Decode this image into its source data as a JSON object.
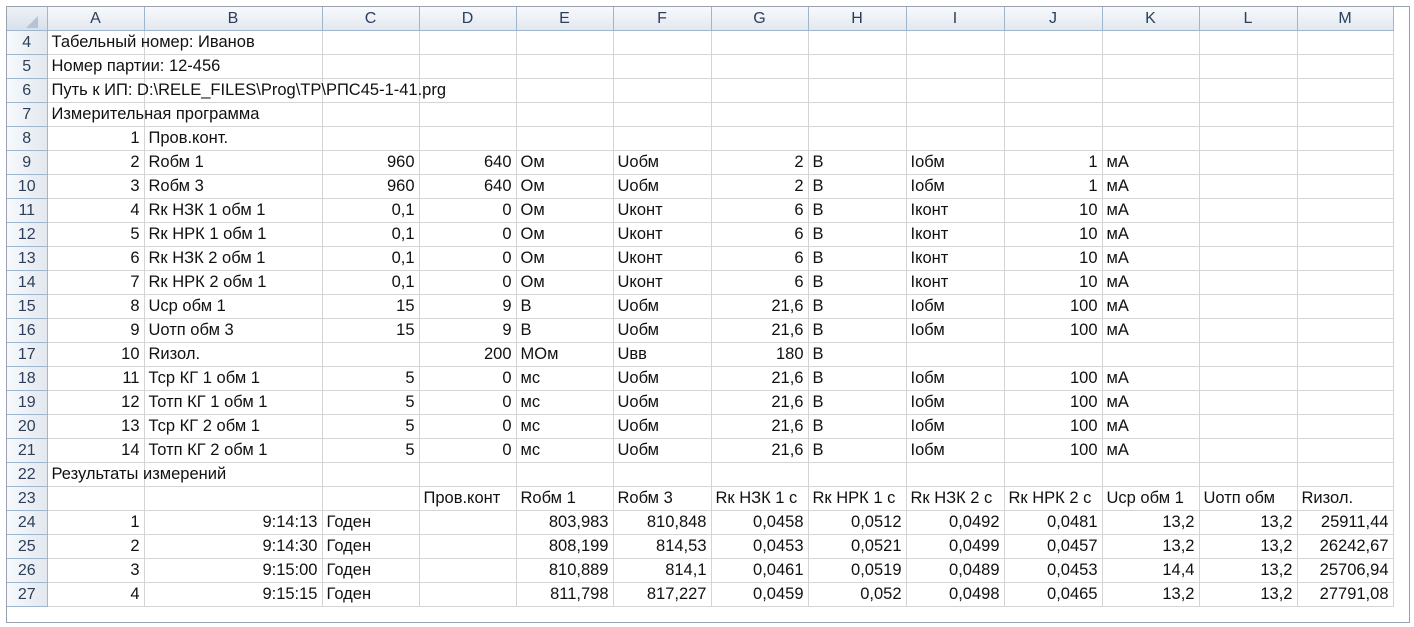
{
  "columns": [
    "A",
    "B",
    "C",
    "D",
    "E",
    "F",
    "G",
    "H",
    "I",
    "J",
    "K",
    "L",
    "M"
  ],
  "rows": [
    {
      "row": "4",
      "cells": [
        {
          "v": "Табельный номер: Иванов",
          "t": "txt",
          "span": 1
        }
      ]
    },
    {
      "row": "5",
      "cells": [
        {
          "v": "Номер партии: 12-456",
          "t": "txt"
        }
      ]
    },
    {
      "row": "6",
      "cells": [
        {
          "v": "Путь к ИП: D:\\RELE_FILES\\Prog\\TP\\РПС45-1-41.prg",
          "t": "txt"
        }
      ]
    },
    {
      "row": "7",
      "cells": [
        {
          "v": "Измерительная программа",
          "t": "txt"
        }
      ]
    },
    {
      "row": "8",
      "cells": [
        {
          "v": "1",
          "t": "num"
        },
        {
          "v": "Пров.конт.",
          "t": "txt"
        }
      ]
    },
    {
      "row": "9",
      "cells": [
        {
          "v": "2",
          "t": "num"
        },
        {
          "v": "Rобм 1",
          "t": "txt"
        },
        {
          "v": "960",
          "t": "num"
        },
        {
          "v": "640",
          "t": "num"
        },
        {
          "v": "Ом",
          "t": "txt"
        },
        {
          "v": "Uобм",
          "t": "txt"
        },
        {
          "v": "2",
          "t": "num"
        },
        {
          "v": "В",
          "t": "txt"
        },
        {
          "v": "Iобм",
          "t": "txt"
        },
        {
          "v": "1",
          "t": "num"
        },
        {
          "v": "мА",
          "t": "txt"
        },
        {
          "v": "",
          "t": "txt"
        },
        {
          "v": "",
          "t": "txt"
        }
      ]
    },
    {
      "row": "10",
      "cells": [
        {
          "v": "3",
          "t": "num"
        },
        {
          "v": "Rобм 3",
          "t": "txt"
        },
        {
          "v": "960",
          "t": "num"
        },
        {
          "v": "640",
          "t": "num"
        },
        {
          "v": "Ом",
          "t": "txt"
        },
        {
          "v": "Uобм",
          "t": "txt"
        },
        {
          "v": "2",
          "t": "num"
        },
        {
          "v": "В",
          "t": "txt"
        },
        {
          "v": "Iобм",
          "t": "txt"
        },
        {
          "v": "1",
          "t": "num"
        },
        {
          "v": "мА",
          "t": "txt"
        },
        {
          "v": "",
          "t": "txt"
        },
        {
          "v": "",
          "t": "txt"
        }
      ]
    },
    {
      "row": "11",
      "cells": [
        {
          "v": "4",
          "t": "num"
        },
        {
          "v": "Rк НЗК 1 обм 1",
          "t": "txt"
        },
        {
          "v": "0,1",
          "t": "num"
        },
        {
          "v": "0",
          "t": "num"
        },
        {
          "v": "Ом",
          "t": "txt"
        },
        {
          "v": "Uконт",
          "t": "txt"
        },
        {
          "v": "6",
          "t": "num"
        },
        {
          "v": "В",
          "t": "txt"
        },
        {
          "v": "Iконт",
          "t": "txt"
        },
        {
          "v": "10",
          "t": "num"
        },
        {
          "v": "мА",
          "t": "txt"
        },
        {
          "v": "",
          "t": "txt"
        },
        {
          "v": "",
          "t": "txt"
        }
      ]
    },
    {
      "row": "12",
      "cells": [
        {
          "v": "5",
          "t": "num"
        },
        {
          "v": "Rк НРК 1 обм 1",
          "t": "txt"
        },
        {
          "v": "0,1",
          "t": "num"
        },
        {
          "v": "0",
          "t": "num"
        },
        {
          "v": "Ом",
          "t": "txt"
        },
        {
          "v": "Uконт",
          "t": "txt"
        },
        {
          "v": "6",
          "t": "num"
        },
        {
          "v": "В",
          "t": "txt"
        },
        {
          "v": "Iконт",
          "t": "txt"
        },
        {
          "v": "10",
          "t": "num"
        },
        {
          "v": "мА",
          "t": "txt"
        },
        {
          "v": "",
          "t": "txt"
        },
        {
          "v": "",
          "t": "txt"
        }
      ]
    },
    {
      "row": "13",
      "cells": [
        {
          "v": "6",
          "t": "num"
        },
        {
          "v": "Rк НЗК 2 обм 1",
          "t": "txt"
        },
        {
          "v": "0,1",
          "t": "num"
        },
        {
          "v": "0",
          "t": "num"
        },
        {
          "v": "Ом",
          "t": "txt"
        },
        {
          "v": "Uконт",
          "t": "txt"
        },
        {
          "v": "6",
          "t": "num"
        },
        {
          "v": "В",
          "t": "txt"
        },
        {
          "v": "Iконт",
          "t": "txt"
        },
        {
          "v": "10",
          "t": "num"
        },
        {
          "v": "мА",
          "t": "txt"
        },
        {
          "v": "",
          "t": "txt"
        },
        {
          "v": "",
          "t": "txt"
        }
      ]
    },
    {
      "row": "14",
      "cells": [
        {
          "v": "7",
          "t": "num"
        },
        {
          "v": "Rк НРК 2 обм 1",
          "t": "txt"
        },
        {
          "v": "0,1",
          "t": "num"
        },
        {
          "v": "0",
          "t": "num"
        },
        {
          "v": "Ом",
          "t": "txt"
        },
        {
          "v": "Uконт",
          "t": "txt"
        },
        {
          "v": "6",
          "t": "num"
        },
        {
          "v": "В",
          "t": "txt"
        },
        {
          "v": "Iконт",
          "t": "txt"
        },
        {
          "v": "10",
          "t": "num"
        },
        {
          "v": "мА",
          "t": "txt"
        },
        {
          "v": "",
          "t": "txt"
        },
        {
          "v": "",
          "t": "txt"
        }
      ]
    },
    {
      "row": "15",
      "cells": [
        {
          "v": "8",
          "t": "num"
        },
        {
          "v": "Uср обм 1",
          "t": "txt"
        },
        {
          "v": "15",
          "t": "num"
        },
        {
          "v": "9",
          "t": "num"
        },
        {
          "v": "В",
          "t": "txt"
        },
        {
          "v": "Uобм",
          "t": "txt"
        },
        {
          "v": "21,6",
          "t": "num"
        },
        {
          "v": "В",
          "t": "txt"
        },
        {
          "v": "Iобм",
          "t": "txt"
        },
        {
          "v": "100",
          "t": "num"
        },
        {
          "v": "мА",
          "t": "txt"
        },
        {
          "v": "",
          "t": "txt"
        },
        {
          "v": "",
          "t": "txt"
        }
      ]
    },
    {
      "row": "16",
      "cells": [
        {
          "v": "9",
          "t": "num"
        },
        {
          "v": "Uотп обм 3",
          "t": "txt"
        },
        {
          "v": "15",
          "t": "num"
        },
        {
          "v": "9",
          "t": "num"
        },
        {
          "v": "В",
          "t": "txt"
        },
        {
          "v": "Uобм",
          "t": "txt"
        },
        {
          "v": "21,6",
          "t": "num"
        },
        {
          "v": "В",
          "t": "txt"
        },
        {
          "v": "Iобм",
          "t": "txt"
        },
        {
          "v": "100",
          "t": "num"
        },
        {
          "v": "мА",
          "t": "txt"
        },
        {
          "v": "",
          "t": "txt"
        },
        {
          "v": "",
          "t": "txt"
        }
      ]
    },
    {
      "row": "17",
      "cells": [
        {
          "v": "10",
          "t": "num"
        },
        {
          "v": "Rизол.",
          "t": "txt"
        },
        {
          "v": "",
          "t": "num"
        },
        {
          "v": "200",
          "t": "num"
        },
        {
          "v": "МОм",
          "t": "txt"
        },
        {
          "v": "Uвв",
          "t": "txt"
        },
        {
          "v": "180",
          "t": "num"
        },
        {
          "v": "В",
          "t": "txt"
        },
        {
          "v": "",
          "t": "txt"
        },
        {
          "v": "",
          "t": "num"
        },
        {
          "v": "",
          "t": "txt"
        },
        {
          "v": "",
          "t": "txt"
        },
        {
          "v": "",
          "t": "txt"
        }
      ]
    },
    {
      "row": "18",
      "cells": [
        {
          "v": "11",
          "t": "num"
        },
        {
          "v": "Тср КГ 1 обм 1",
          "t": "txt"
        },
        {
          "v": "5",
          "t": "num"
        },
        {
          "v": "0",
          "t": "num"
        },
        {
          "v": "мс",
          "t": "txt"
        },
        {
          "v": "Uобм",
          "t": "txt"
        },
        {
          "v": "21,6",
          "t": "num"
        },
        {
          "v": "В",
          "t": "txt"
        },
        {
          "v": "Iобм",
          "t": "txt"
        },
        {
          "v": "100",
          "t": "num"
        },
        {
          "v": "мА",
          "t": "txt"
        },
        {
          "v": "",
          "t": "txt"
        },
        {
          "v": "",
          "t": "txt"
        }
      ]
    },
    {
      "row": "19",
      "cells": [
        {
          "v": "12",
          "t": "num"
        },
        {
          "v": "Тотп КГ 1 обм 1",
          "t": "txt"
        },
        {
          "v": "5",
          "t": "num"
        },
        {
          "v": "0",
          "t": "num"
        },
        {
          "v": "мс",
          "t": "txt"
        },
        {
          "v": "Uобм",
          "t": "txt"
        },
        {
          "v": "21,6",
          "t": "num"
        },
        {
          "v": "В",
          "t": "txt"
        },
        {
          "v": "Iобм",
          "t": "txt"
        },
        {
          "v": "100",
          "t": "num"
        },
        {
          "v": "мА",
          "t": "txt"
        },
        {
          "v": "",
          "t": "txt"
        },
        {
          "v": "",
          "t": "txt"
        }
      ]
    },
    {
      "row": "20",
      "cells": [
        {
          "v": "13",
          "t": "num"
        },
        {
          "v": "Тср КГ 2 обм 1",
          "t": "txt"
        },
        {
          "v": "5",
          "t": "num"
        },
        {
          "v": "0",
          "t": "num"
        },
        {
          "v": "мс",
          "t": "txt"
        },
        {
          "v": "Uобм",
          "t": "txt"
        },
        {
          "v": "21,6",
          "t": "num"
        },
        {
          "v": "В",
          "t": "txt"
        },
        {
          "v": "Iобм",
          "t": "txt"
        },
        {
          "v": "100",
          "t": "num"
        },
        {
          "v": "мА",
          "t": "txt"
        },
        {
          "v": "",
          "t": "txt"
        },
        {
          "v": "",
          "t": "txt"
        }
      ]
    },
    {
      "row": "21",
      "cells": [
        {
          "v": "14",
          "t": "num"
        },
        {
          "v": "Тотп КГ 2 обм 1",
          "t": "txt"
        },
        {
          "v": "5",
          "t": "num"
        },
        {
          "v": "0",
          "t": "num"
        },
        {
          "v": "мс",
          "t": "txt"
        },
        {
          "v": "Uобм",
          "t": "txt"
        },
        {
          "v": "21,6",
          "t": "num"
        },
        {
          "v": "В",
          "t": "txt"
        },
        {
          "v": "Iобм",
          "t": "txt"
        },
        {
          "v": "100",
          "t": "num"
        },
        {
          "v": "мА",
          "t": "txt"
        },
        {
          "v": "",
          "t": "txt"
        },
        {
          "v": "",
          "t": "txt"
        }
      ]
    },
    {
      "row": "22",
      "cells": [
        {
          "v": "Результаты измерений",
          "t": "txt"
        }
      ]
    },
    {
      "row": "23",
      "cells": [
        {
          "v": "",
          "t": "txt"
        },
        {
          "v": "",
          "t": "txt"
        },
        {
          "v": "",
          "t": "txt"
        },
        {
          "v": "Пров.конт",
          "t": "txt"
        },
        {
          "v": "Rобм 1",
          "t": "txt"
        },
        {
          "v": "Rобм 3",
          "t": "txt"
        },
        {
          "v": "Rк НЗК 1 с",
          "t": "txt"
        },
        {
          "v": "Rк НРК 1 с",
          "t": "txt"
        },
        {
          "v": "Rк НЗК 2 с",
          "t": "txt"
        },
        {
          "v": "Rк НРК 2 с",
          "t": "txt"
        },
        {
          "v": "Uср обм 1",
          "t": "txt"
        },
        {
          "v": "Uотп обм",
          "t": "txt"
        },
        {
          "v": "Rизол.",
          "t": "txt"
        }
      ]
    },
    {
      "row": "24",
      "cells": [
        {
          "v": "1",
          "t": "num"
        },
        {
          "v": "9:14:13",
          "t": "num"
        },
        {
          "v": "Годен",
          "t": "txt"
        },
        {
          "v": "",
          "t": "txt"
        },
        {
          "v": "803,983",
          "t": "num"
        },
        {
          "v": "810,848",
          "t": "num"
        },
        {
          "v": "0,0458",
          "t": "num"
        },
        {
          "v": "0,0512",
          "t": "num"
        },
        {
          "v": "0,0492",
          "t": "num"
        },
        {
          "v": "0,0481",
          "t": "num"
        },
        {
          "v": "13,2",
          "t": "num"
        },
        {
          "v": "13,2",
          "t": "num"
        },
        {
          "v": "25911,44",
          "t": "num"
        }
      ]
    },
    {
      "row": "25",
      "cells": [
        {
          "v": "2",
          "t": "num"
        },
        {
          "v": "9:14:30",
          "t": "num"
        },
        {
          "v": "Годен",
          "t": "txt"
        },
        {
          "v": "",
          "t": "txt"
        },
        {
          "v": "808,199",
          "t": "num"
        },
        {
          "v": "814,53",
          "t": "num"
        },
        {
          "v": "0,0453",
          "t": "num"
        },
        {
          "v": "0,0521",
          "t": "num"
        },
        {
          "v": "0,0499",
          "t": "num"
        },
        {
          "v": "0,0457",
          "t": "num"
        },
        {
          "v": "13,2",
          "t": "num"
        },
        {
          "v": "13,2",
          "t": "num"
        },
        {
          "v": "26242,67",
          "t": "num"
        }
      ]
    },
    {
      "row": "26",
      "cells": [
        {
          "v": "3",
          "t": "num"
        },
        {
          "v": "9:15:00",
          "t": "num"
        },
        {
          "v": "Годен",
          "t": "txt"
        },
        {
          "v": "",
          "t": "txt"
        },
        {
          "v": "810,889",
          "t": "num"
        },
        {
          "v": "814,1",
          "t": "num"
        },
        {
          "v": "0,0461",
          "t": "num"
        },
        {
          "v": "0,0519",
          "t": "num"
        },
        {
          "v": "0,0489",
          "t": "num"
        },
        {
          "v": "0,0453",
          "t": "num"
        },
        {
          "v": "14,4",
          "t": "num"
        },
        {
          "v": "13,2",
          "t": "num"
        },
        {
          "v": "25706,94",
          "t": "num"
        }
      ]
    },
    {
      "row": "27",
      "cells": [
        {
          "v": "4",
          "t": "num"
        },
        {
          "v": "9:15:15",
          "t": "num"
        },
        {
          "v": "Годен",
          "t": "txt"
        },
        {
          "v": "",
          "t": "txt"
        },
        {
          "v": "811,798",
          "t": "num"
        },
        {
          "v": "817,227",
          "t": "num"
        },
        {
          "v": "0,0459",
          "t": "num"
        },
        {
          "v": "0,052",
          "t": "num"
        },
        {
          "v": "0,0498",
          "t": "num"
        },
        {
          "v": "0,0465",
          "t": "num"
        },
        {
          "v": "13,2",
          "t": "num"
        },
        {
          "v": "13,2",
          "t": "num"
        },
        {
          "v": "27791,08",
          "t": "num"
        }
      ]
    }
  ]
}
